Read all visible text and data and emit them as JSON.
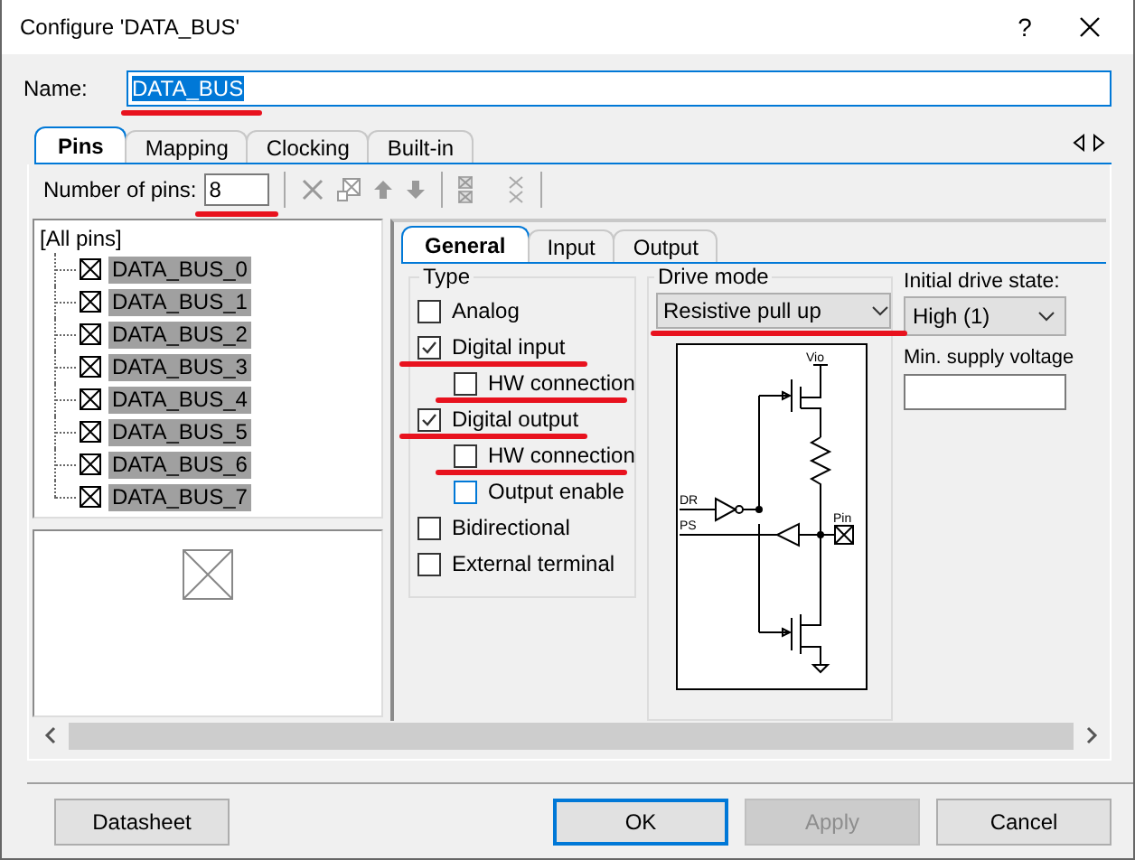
{
  "window": {
    "title": "Configure 'DATA_BUS'",
    "help": "?"
  },
  "name": {
    "label": "Name:",
    "value": "DATA_BUS",
    "selected": true,
    "underlined": true
  },
  "tabs": [
    {
      "label": "Pins",
      "selected": true
    },
    {
      "label": "Mapping",
      "selected": false
    },
    {
      "label": "Clocking",
      "selected": false
    },
    {
      "label": "Built-in",
      "selected": false
    }
  ],
  "pins_toolbar": {
    "label": "Number of pins:",
    "value": "8",
    "underlined": true
  },
  "pin_tree": {
    "root": "[All pins]",
    "children": [
      {
        "label": "DATA_BUS_0",
        "selected": true
      },
      {
        "label": "DATA_BUS_1",
        "selected": true
      },
      {
        "label": "DATA_BUS_2",
        "selected": true
      },
      {
        "label": "DATA_BUS_3",
        "selected": true
      },
      {
        "label": "DATA_BUS_4",
        "selected": true
      },
      {
        "label": "DATA_BUS_5",
        "selected": true
      },
      {
        "label": "DATA_BUS_6",
        "selected": true
      },
      {
        "label": "DATA_BUS_7",
        "selected": true
      }
    ]
  },
  "sub_tabs": [
    {
      "label": "General",
      "selected": true
    },
    {
      "label": "Input",
      "selected": false
    },
    {
      "label": "Output",
      "selected": false
    }
  ],
  "type_group": {
    "title": "Type",
    "options": [
      {
        "label": "Analog",
        "checked": false,
        "focused": false,
        "underlined": false
      },
      {
        "label": "Digital input",
        "checked": true,
        "focused": false,
        "underlined": true,
        "children": [
          {
            "label": "HW connection",
            "checked": false,
            "focused": false,
            "underlined": true
          }
        ]
      },
      {
        "label": "Digital output",
        "checked": true,
        "focused": false,
        "underlined": true,
        "children": [
          {
            "label": "HW connection",
            "checked": false,
            "focused": false,
            "underlined": true
          },
          {
            "label": "Output enable",
            "checked": false,
            "focused": true,
            "underlined": false
          }
        ]
      },
      {
        "label": "Bidirectional",
        "checked": false,
        "focused": false,
        "underlined": false
      },
      {
        "label": "External terminal",
        "checked": false,
        "focused": false,
        "underlined": false
      }
    ]
  },
  "drive_mode": {
    "title": "Drive mode",
    "value": "Resistive pull up",
    "underlined": true
  },
  "schematic": {
    "labels": [
      "Vio",
      "DR",
      "PS",
      "Pin"
    ]
  },
  "initial_drive_state": {
    "label": "Initial drive state:",
    "value": "High (1)"
  },
  "min_supply_voltage": {
    "label": "Min. supply voltage"
  },
  "buttons": [
    {
      "label": "Datasheet",
      "kind": "normal"
    },
    {
      "label": "OK",
      "kind": "default"
    },
    {
      "label": "Apply",
      "kind": "disabled"
    },
    {
      "label": "Cancel",
      "kind": "normal"
    }
  ]
}
